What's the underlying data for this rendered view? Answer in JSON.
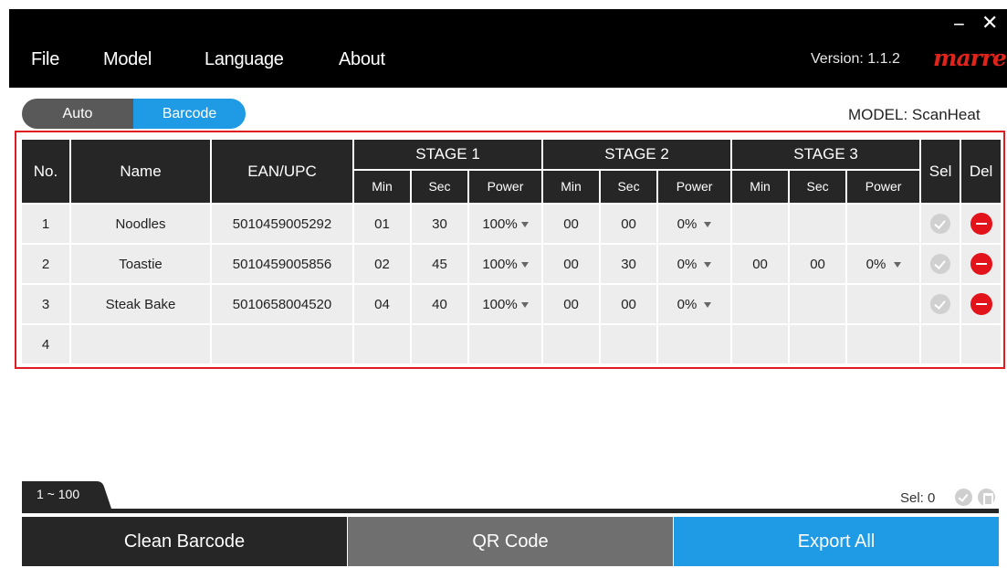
{
  "menu": {
    "file": "File",
    "model": "Model",
    "language": "Language",
    "about": "About"
  },
  "window": {
    "minimize": "−",
    "close": "✕"
  },
  "version": "Version: 1.1.2",
  "brand": "marren",
  "mode_tabs": {
    "auto": "Auto",
    "barcode": "Barcode",
    "active": "Barcode"
  },
  "model_label": "MODEL: ScanHeat",
  "table": {
    "headers": {
      "no": "No.",
      "name": "Name",
      "ean": "EAN/UPC",
      "stage1": "STAGE 1",
      "stage2": "STAGE 2",
      "stage3": "STAGE 3",
      "sel": "Sel",
      "del": "Del",
      "min": "Min",
      "sec": "Sec",
      "power": "Power"
    },
    "rows": [
      {
        "no": "1",
        "name": "Noodles",
        "ean": "5010459005292",
        "s1": {
          "min": "01",
          "sec": "30",
          "power": "100%"
        },
        "s2": {
          "min": "00",
          "sec": "00",
          "power": "0%"
        },
        "s3": {
          "min": "",
          "sec": "",
          "power": ""
        }
      },
      {
        "no": "2",
        "name": "Toastie",
        "ean": "5010459005856",
        "s1": {
          "min": "02",
          "sec": "45",
          "power": "100%"
        },
        "s2": {
          "min": "00",
          "sec": "30",
          "power": "0%"
        },
        "s3": {
          "min": "00",
          "sec": "00",
          "power": "0%"
        }
      },
      {
        "no": "3",
        "name": "Steak Bake",
        "ean": "5010658004520",
        "s1": {
          "min": "04",
          "sec": "40",
          "power": "100%"
        },
        "s2": {
          "min": "00",
          "sec": "00",
          "power": "0%"
        },
        "s3": {
          "min": "",
          "sec": "",
          "power": ""
        }
      },
      {
        "no": "4",
        "name": "",
        "ean": "",
        "s1": {
          "min": "",
          "sec": "",
          "power": ""
        },
        "s2": {
          "min": "",
          "sec": "",
          "power": ""
        },
        "s3": {
          "min": "",
          "sec": "",
          "power": ""
        }
      }
    ]
  },
  "page_tab": "1 ~ 100",
  "sel_count": "Sel:  0",
  "buttons": {
    "clean": "Clean Barcode",
    "qr": "QR Code",
    "export": "Export All"
  },
  "colors": {
    "accent": "#1e9be4",
    "delete": "#e3131b",
    "brand": "#e0241c",
    "frame": "#e11b22"
  },
  "icons": {
    "select": "check-circle-icon",
    "delete": "minus-circle-icon",
    "mini_select": "check-circle-icon",
    "mini_delete": "trash-icon"
  }
}
